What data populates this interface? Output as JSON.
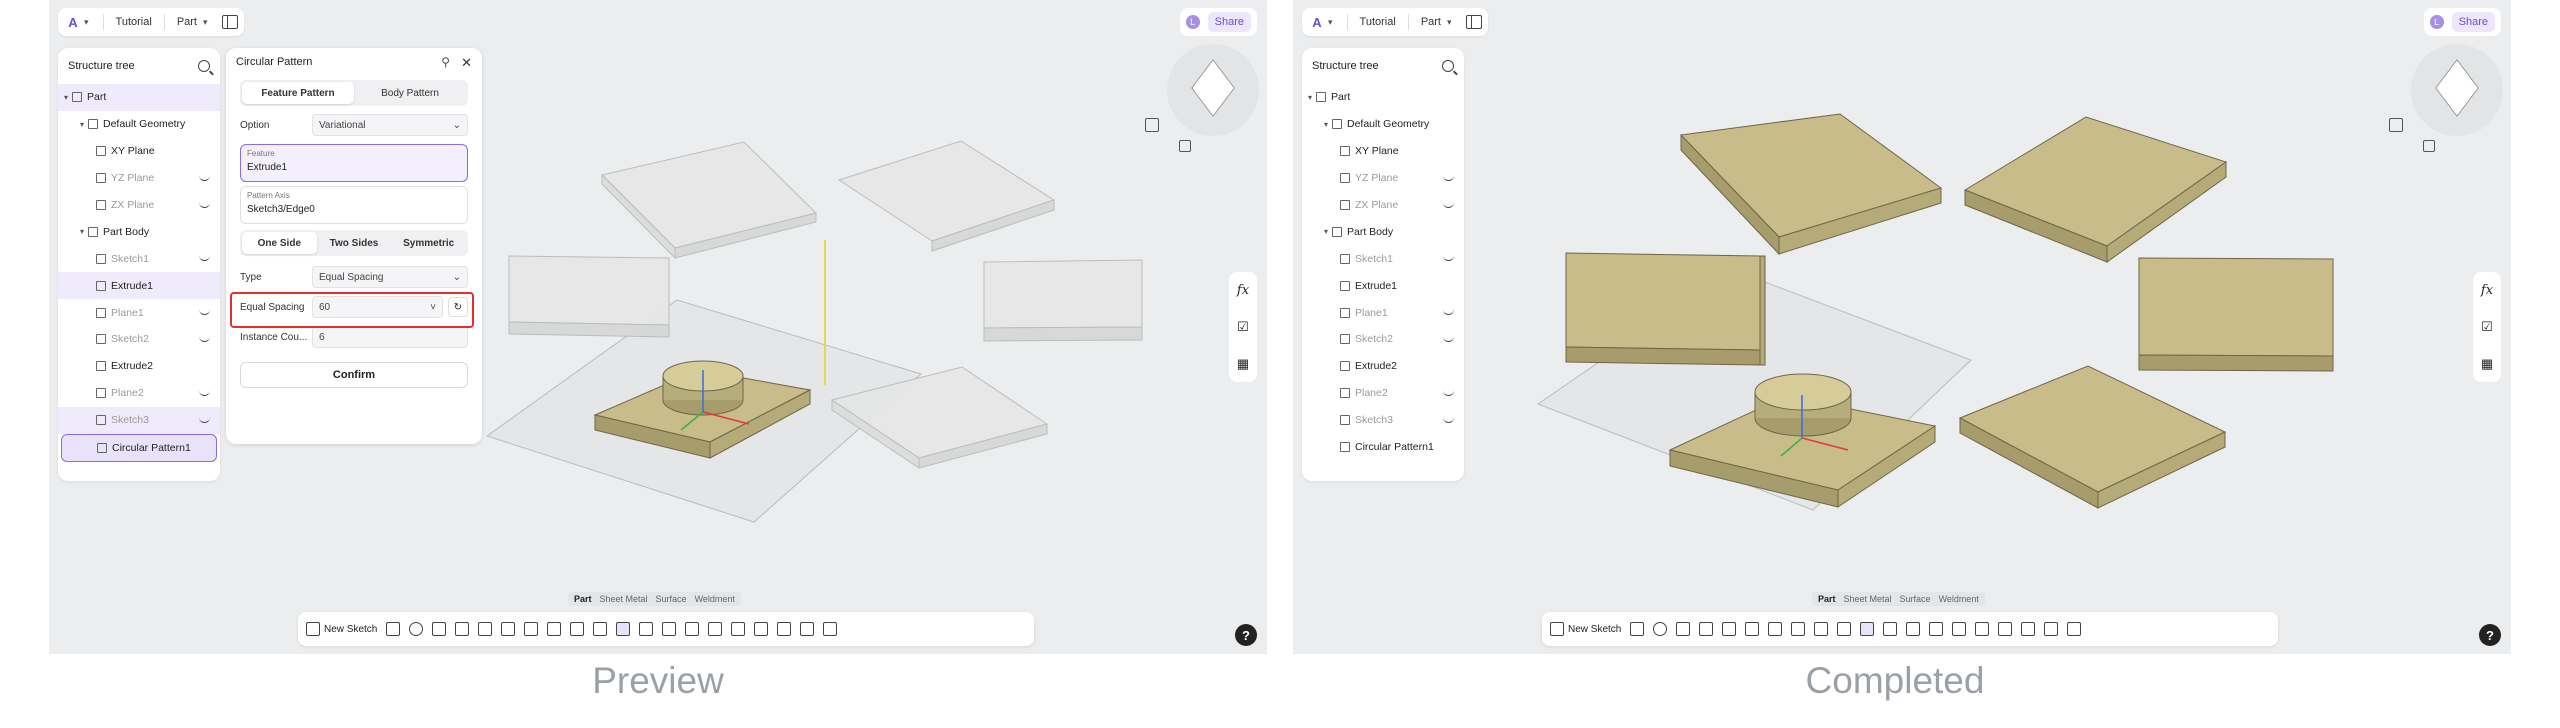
{
  "captions": {
    "left": "Preview",
    "right": "Completed"
  },
  "topbar": {
    "menu_tutorial": "Tutorial",
    "menu_part": "Part",
    "share": "Share",
    "avatar_letter": "L"
  },
  "tree": {
    "title": "Structure tree",
    "items": [
      {
        "label": "Part"
      },
      {
        "label": "Default Geometry"
      },
      {
        "label": "XY Plane"
      },
      {
        "label": "YZ Plane"
      },
      {
        "label": "ZX Plane"
      },
      {
        "label": "Part Body"
      },
      {
        "label": "Sketch1"
      },
      {
        "label": "Extrude1"
      },
      {
        "label": "Plane1"
      },
      {
        "label": "Sketch2"
      },
      {
        "label": "Extrude2"
      },
      {
        "label": "Plane2"
      },
      {
        "label": "Sketch3"
      },
      {
        "label": "Circular Pattern1"
      }
    ]
  },
  "dialog": {
    "title": "Circular Pattern",
    "tab_feature": "Feature Pattern",
    "tab_body": "Body Pattern",
    "option_label": "Option",
    "option_value": "Variational",
    "feature_label": "Feature",
    "feature_value": "Extrude1",
    "axis_label": "Pattern Axis",
    "axis_value": "Sketch3/Edge0",
    "dir_one": "One Side",
    "dir_two": "Two Sides",
    "dir_sym": "Symmetric",
    "type_label": "Type",
    "type_value": "Equal Spacing",
    "spacing_label": "Equal Spacing",
    "spacing_value": "60",
    "count_label": "Instance Cou...",
    "count_value": "6",
    "confirm": "Confirm"
  },
  "bottom": {
    "tabs": [
      "Part",
      "Sheet Metal",
      "Surface",
      "Weldment"
    ],
    "new_sketch": "New Sketch"
  },
  "right_tools": {
    "fx": "fx"
  },
  "help": "?"
}
